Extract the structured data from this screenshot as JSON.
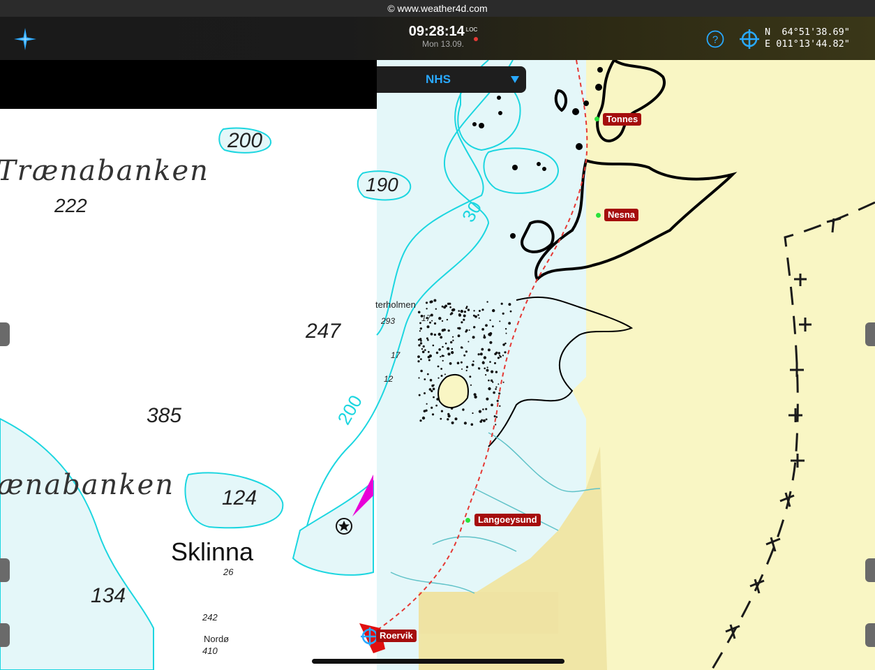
{
  "copyright": "© www.weather4d.com",
  "clock": {
    "time": "09:28:14",
    "tz_badge": "LOC",
    "date": "Mon 13.09."
  },
  "position": {
    "lat": "N  64°51'38.69\"",
    "lon": "E 011°13'44.82\""
  },
  "layer": {
    "selected": "NHS"
  },
  "icons": {
    "compass": "compass-rose-icon",
    "help": "help-icon",
    "gps": "gps-target-icon"
  },
  "colors": {
    "land": "#f9f6c4",
    "sea": "#e4f7f9",
    "depth_contour": "#1cd6e0",
    "route": "#e53935",
    "port_badge": "#a50d0d",
    "accent": "#29a9ff"
  },
  "ports": [
    {
      "name": "Tonnes"
    },
    {
      "name": "Nesna"
    },
    {
      "name": "Langoeysund"
    },
    {
      "name": "Roervik"
    }
  ],
  "chart_labels": {
    "traenabanken_1": "Trænabanken",
    "traenabanken_2": "ænabanken",
    "sklinna": "Sklinna",
    "terholmen": "terholmen",
    "nordo": "Nordø",
    "d200a": "200",
    "d190": "190",
    "d222": "222",
    "d247": "247",
    "d385": "385",
    "d124": "124",
    "d134": "134",
    "d293": "293",
    "d17a": "17",
    "d17b": "17",
    "d12": "12",
    "d242": "242",
    "d410": "410",
    "d26": "26",
    "c30": "30",
    "c200": "200"
  }
}
